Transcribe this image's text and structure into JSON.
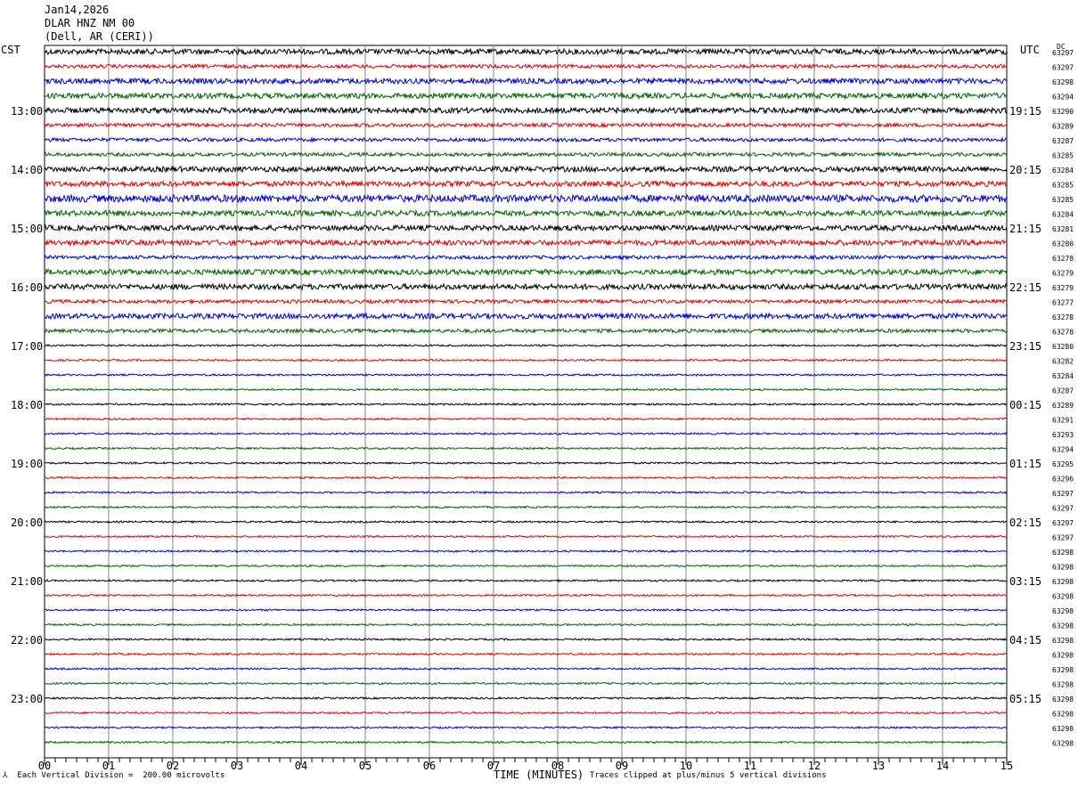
{
  "header": {
    "date": "Jan14,2026",
    "station": "DLAR HNZ NM 00",
    "location": "(Dell, AR (CERI))"
  },
  "left_tz": "CST",
  "right_tz": "UTC",
  "dc_label": "DC",
  "footer": {
    "scale": "Each Vertical Division =  200.00 microvolts",
    "clip": "Traces clipped at plus/minus 5 vertical divisions",
    "xaxis_title": "TIME (MINUTES)"
  },
  "colors": {
    "line_cycle": [
      "#000000",
      "#e00000",
      "#0000d0",
      "#006400"
    ],
    "grid": "#808080"
  },
  "chart_data": {
    "type": "line",
    "title": "",
    "xlabel": "TIME (MINUTES)",
    "x_ticks": [
      "00",
      "01",
      "02",
      "03",
      "04",
      "05",
      "06",
      "07",
      "08",
      "09",
      "10",
      "11",
      "12",
      "13",
      "14",
      "15"
    ],
    "xlim": [
      0,
      15
    ],
    "left_time_labels": [
      "13:00",
      "14:00",
      "15:00",
      "16:00",
      "17:00",
      "18:00",
      "19:00",
      "20:00",
      "21:00",
      "22:00",
      "23:00"
    ],
    "right_time_labels": [
      "19:15",
      "20:15",
      "21:15",
      "22:15",
      "23:15",
      "00:15",
      "01:15",
      "02:15",
      "03:15",
      "04:15",
      "05:15"
    ],
    "dc_offsets": [
      "63297",
      "63297",
      "63298",
      "63294",
      "63290",
      "63289",
      "63287",
      "63285",
      "63284",
      "63285",
      "63285",
      "63284",
      "63281",
      "63280",
      "63278",
      "63279",
      "63279",
      "63277",
      "63278",
      "63278",
      "63280",
      "63282",
      "63284",
      "63287",
      "63289",
      "63291",
      "63293",
      "63294",
      "63295",
      "63296",
      "63297",
      "63297",
      "63297",
      "63297",
      "63298",
      "63298",
      "63298",
      "63298",
      "63298",
      "63298",
      "63298",
      "63298",
      "63298",
      "63298",
      "63298",
      "63298",
      "63298",
      "63298"
    ],
    "trace_amplitudes": [
      3,
      2,
      3,
      3,
      3,
      2,
      2,
      2,
      3,
      3,
      4,
      3,
      3,
      3,
      2,
      3,
      3,
      2,
      3,
      2,
      1,
      1,
      1,
      1,
      1,
      1,
      1,
      1,
      1,
      1,
      1,
      1,
      1,
      1,
      1,
      1,
      1,
      1,
      1,
      1,
      1,
      1,
      1,
      1,
      1,
      1,
      1,
      1
    ],
    "series_colors": [
      "black",
      "red",
      "blue",
      "green"
    ]
  }
}
